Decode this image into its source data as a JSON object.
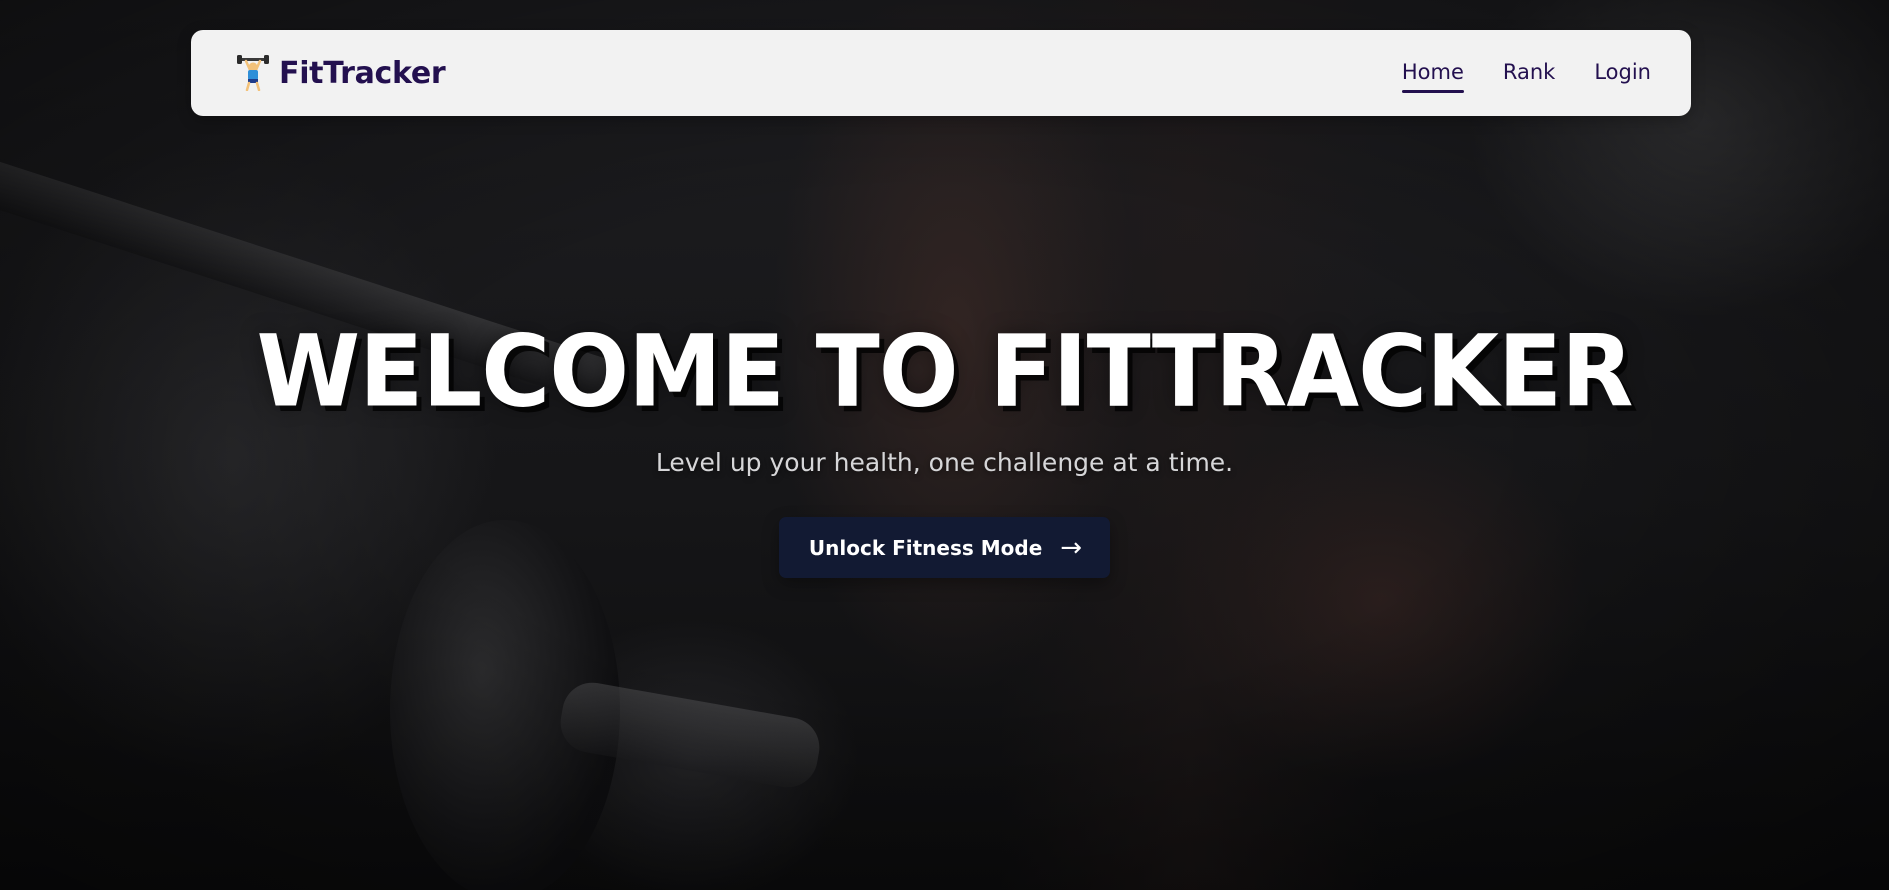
{
  "navbar": {
    "brand_icon": "weightlifter-icon",
    "brand_name": "FitTracker",
    "links": [
      {
        "label": "Home",
        "active": true
      },
      {
        "label": "Rank",
        "active": false
      },
      {
        "label": "Login",
        "active": false
      }
    ]
  },
  "hero": {
    "title": "WELCOME TO FITTRACKER",
    "subtitle": "Level up your health, one challenge at a time.",
    "cta_label": "Unlock Fitness Mode",
    "cta_icon": "arrow-right-icon",
    "background": "gym-dumbbell-photo"
  },
  "colors": {
    "brand": "#23104f",
    "cta_background": "#121a33",
    "navbar_background": "#f2f2f2",
    "hero_text": "#ffffff",
    "subtitle_text": "#d6d6d8"
  }
}
